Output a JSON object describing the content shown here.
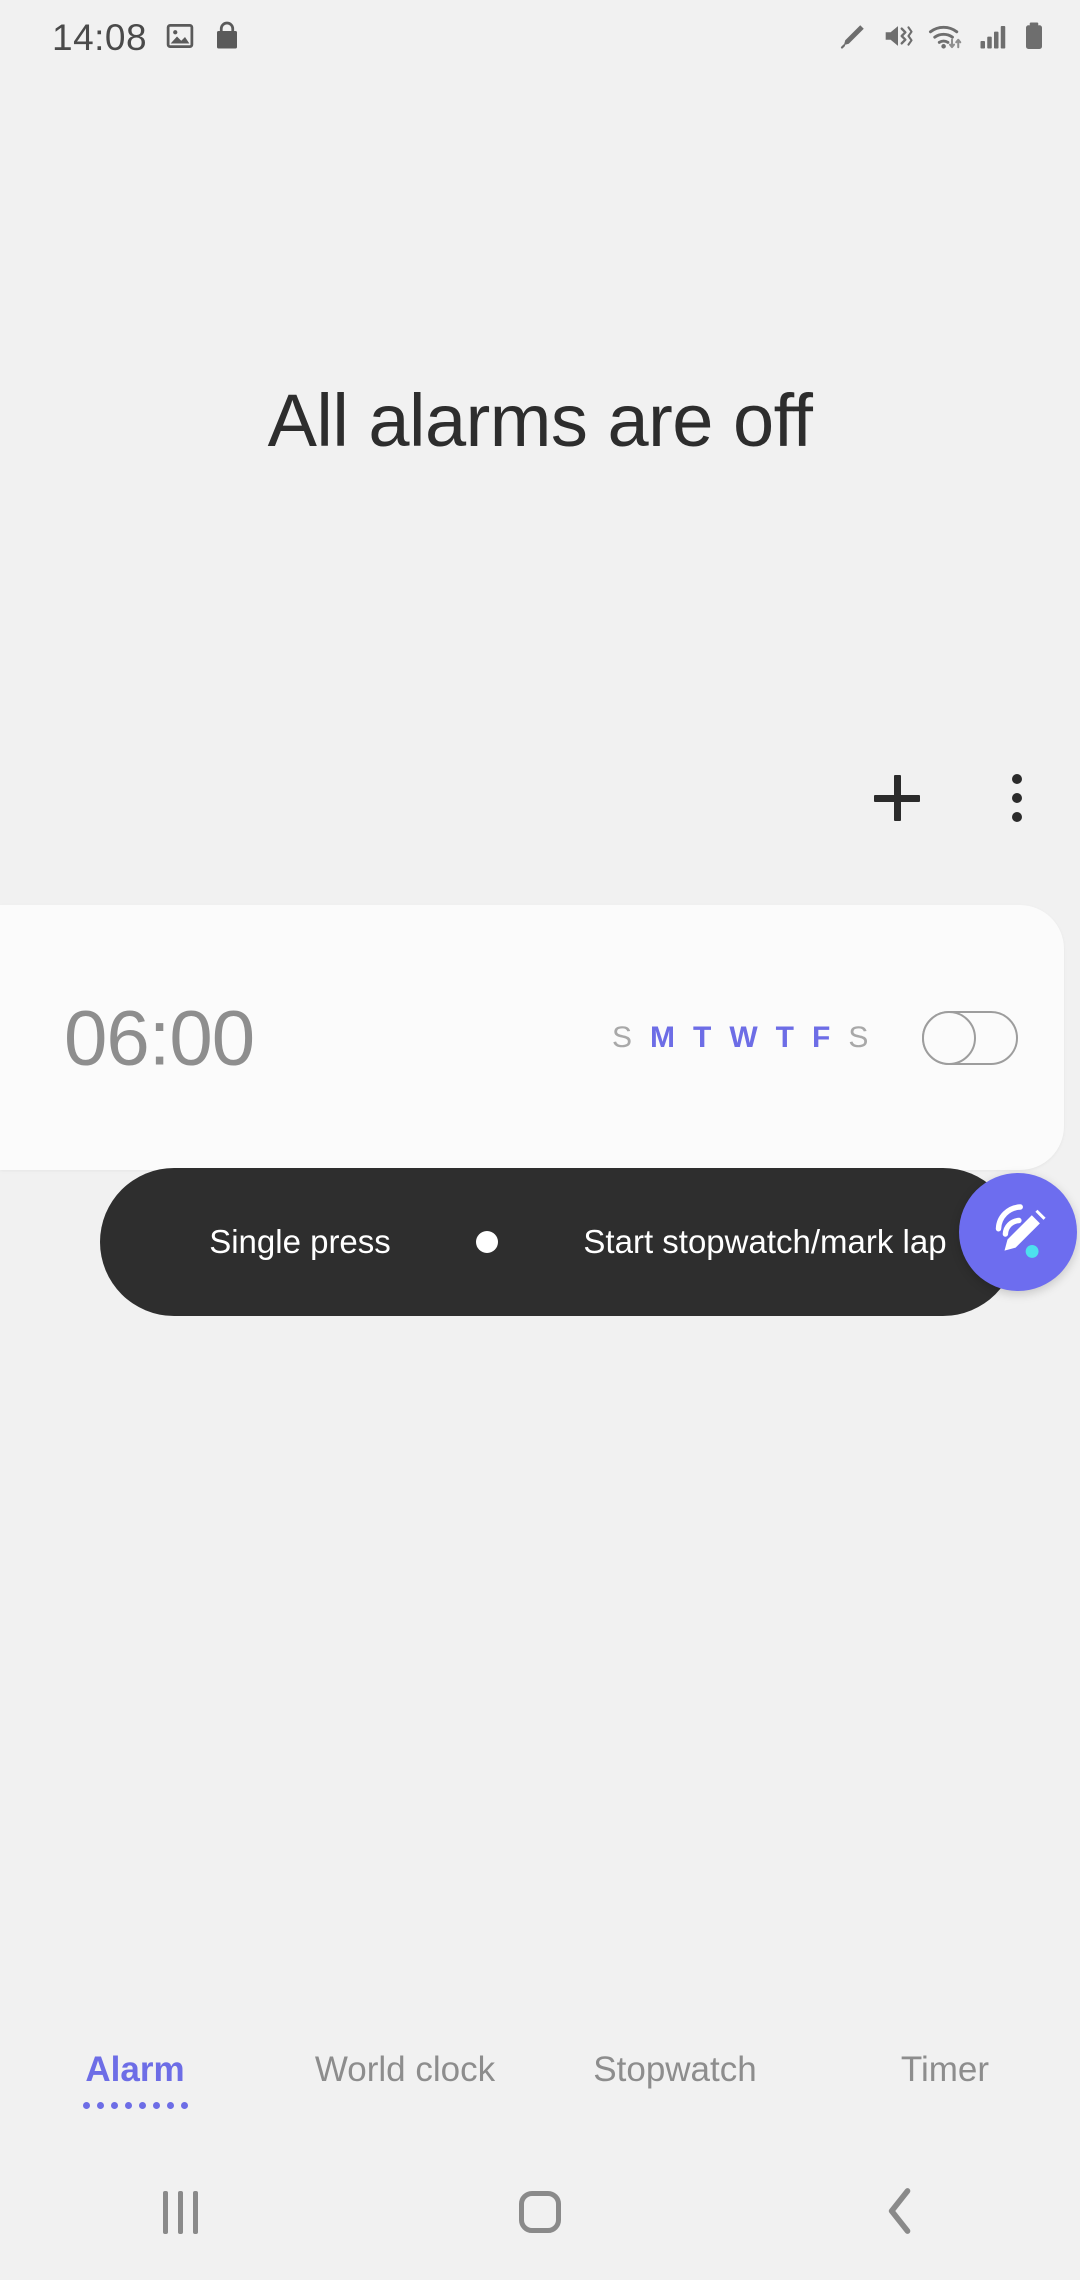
{
  "status_bar": {
    "clock": "14:08",
    "left_icons": [
      "image-icon",
      "shopping-bag-icon"
    ],
    "right_icons": [
      "spen-icon",
      "mute-vibrate-icon",
      "wifi-icon",
      "signal-icon",
      "battery-icon"
    ]
  },
  "header": {
    "title": "All alarms are off",
    "add_label": "Add alarm",
    "more_label": "More options"
  },
  "alarms": [
    {
      "time": "06:00",
      "days": [
        {
          "letter": "S",
          "active": false
        },
        {
          "letter": "M",
          "active": true
        },
        {
          "letter": "T",
          "active": true
        },
        {
          "letter": "W",
          "active": true
        },
        {
          "letter": "T",
          "active": true
        },
        {
          "letter": "F",
          "active": true
        },
        {
          "letter": "S",
          "active": false
        }
      ],
      "enabled": false
    }
  ],
  "spen_tooltip": {
    "gesture": "Single press",
    "action": "Start stopwatch/mark lap",
    "fab_icon": "spen-air-action-icon"
  },
  "tabs": [
    {
      "label": "Alarm",
      "active": true
    },
    {
      "label": "World clock",
      "active": false
    },
    {
      "label": "Stopwatch",
      "active": false
    },
    {
      "label": "Timer",
      "active": false
    }
  ],
  "nav_bar": {
    "recents_label": "Recents",
    "home_label": "Home",
    "back_label": "Back"
  },
  "colors": {
    "page_bg": "#f1f1f1",
    "card_bg": "#fbfbfb",
    "accent": "#6d6de6",
    "fab": "#6d6def",
    "tooltip_bg": "#2e2e2e",
    "text_primary": "#2d2d2d",
    "text_muted": "#8e8e8e"
  }
}
